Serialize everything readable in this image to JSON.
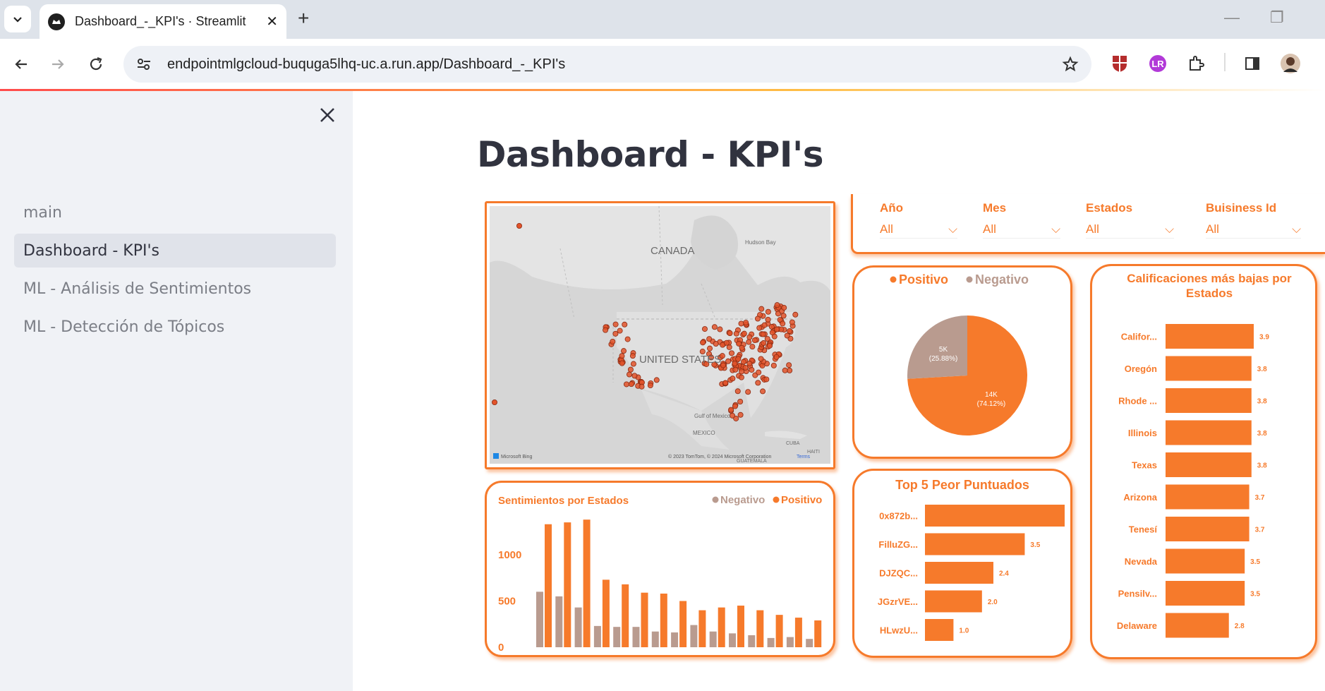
{
  "browser": {
    "tab_title": "Dashboard_-_KPI's · Streamlit",
    "url": "endpointmlgcloud-buquga5lhq-uc.a.run.app/Dashboard_-_KPI's"
  },
  "sidebar": {
    "items": [
      {
        "label": "main"
      },
      {
        "label": "Dashboard - KPI's"
      },
      {
        "label": "ML - Análisis de Sentimientos"
      },
      {
        "label": "ML - Detección de Tópicos"
      }
    ]
  },
  "page": {
    "title": "Dashboard - KPI's"
  },
  "map": {
    "label_canada": "CANADA",
    "label_us": "UNITED STATES",
    "label_mexico": "MEXICO",
    "label_hudson": "Hudson Bay",
    "label_gulf": "Gulf of Mexico",
    "label_cuba": "CUBA",
    "label_haiti": "HAITI",
    "label_guatemala": "GUATEMALA",
    "bing": "Microsoft Bing",
    "copyright": "© 2023 TomTom, © 2024 Microsoft Corporation",
    "terms": "Terms"
  },
  "filters": [
    {
      "label": "Año",
      "value": "All"
    },
    {
      "label": "Mes",
      "value": "All"
    },
    {
      "label": "Estados",
      "value": "All"
    },
    {
      "label": "Buisiness Id",
      "value": "All"
    }
  ],
  "colors": {
    "accent": "#f67a2b",
    "negative": "#b99b8f",
    "sidebar_bg": "#f0f2f6"
  },
  "pie": {
    "legend": [
      "Positivo",
      "Negativo"
    ],
    "slices": [
      {
        "label": "Positivo",
        "value_text": "14K",
        "pct_text": "(74.12%)",
        "pct": 74.12
      },
      {
        "label": "Negativo",
        "value_text": "5K",
        "pct_text": "(25.88%)",
        "pct": 25.88
      }
    ]
  },
  "chart_data": [
    {
      "type": "bar",
      "title": "Sentimientos por Estados",
      "legend": [
        "Negativo",
        "Positivo"
      ],
      "ylim": [
        0,
        1450
      ],
      "yticks": [
        0,
        500,
        1000
      ],
      "series": [
        {
          "name": "Negativo",
          "values": [
            600,
            550,
            430,
            230,
            220,
            220,
            170,
            160,
            240,
            170,
            150,
            130,
            100,
            110,
            90
          ]
        },
        {
          "name": "Positivo",
          "values": [
            1330,
            1350,
            1380,
            730,
            680,
            590,
            580,
            500,
            400,
            430,
            450,
            400,
            350,
            320,
            290
          ]
        }
      ]
    },
    {
      "type": "bar",
      "title": "Top 5 Peor Puntuados",
      "categories": [
        "0x872b...",
        "FilluZG...",
        "DJZQC...",
        "JGzrVE...",
        "HLwzU..."
      ],
      "values": [
        4.9,
        3.5,
        2.4,
        2.0,
        1.0
      ],
      "labels": [
        "",
        "3.5",
        "2.4",
        "2.0",
        "1.0"
      ]
    },
    {
      "type": "bar",
      "title": "Calificaciones más bajas por Estados",
      "categories": [
        "Califor...",
        "Oregón",
        "Rhode ...",
        "Illinois",
        "Texas",
        "Arizona",
        "Tenesí",
        "Nevada",
        "Pensilv...",
        "Delaware"
      ],
      "values": [
        3.9,
        3.8,
        3.8,
        3.8,
        3.8,
        3.7,
        3.7,
        3.5,
        3.5,
        2.8
      ],
      "labels": [
        "3.9",
        "3.8",
        "3.8",
        "3.8",
        "3.8",
        "3.7",
        "3.7",
        "3.5",
        "3.5",
        "2.8"
      ]
    }
  ]
}
